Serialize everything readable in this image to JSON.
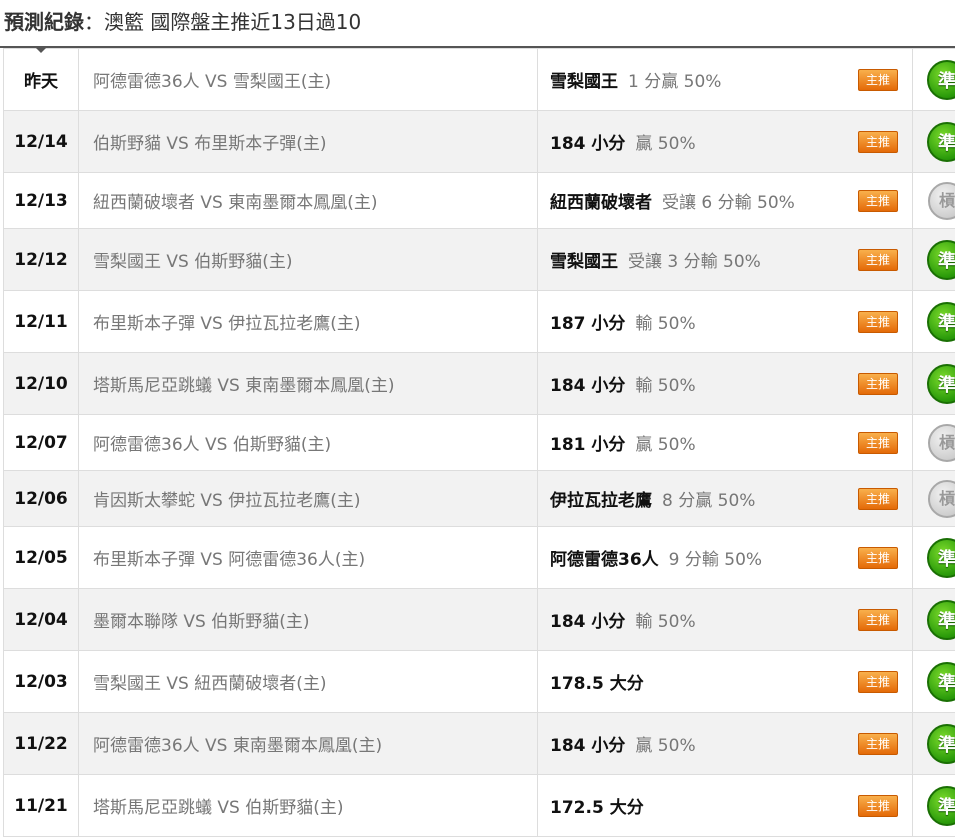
{
  "header": {
    "label": "預測紀錄",
    "sep": "：",
    "subtitle": "澳籃 國際盤主推近13日過10"
  },
  "rows": [
    {
      "date": "昨天",
      "match": "阿德雷德36人 VS 雪梨國王(主)",
      "pick_team": "雪梨國王",
      "pick_line": "1 分贏 50%",
      "badge": "主推",
      "result": "準",
      "result_type": "win"
    },
    {
      "date": "12/14",
      "match": "伯斯野貓 VS 布里斯本子彈(主)",
      "pick_team": "184 小分",
      "pick_line": "贏 50%",
      "badge": "主推",
      "result": "準",
      "result_type": "win"
    },
    {
      "date": "12/13",
      "match": "紐西蘭破壞者 VS 東南墨爾本鳳凰(主)",
      "pick_team": "紐西蘭破壞者",
      "pick_line": "受讓 6 分輸 50%",
      "badge": "主推",
      "result": "槓",
      "result_type": "lose"
    },
    {
      "date": "12/12",
      "match": "雪梨國王 VS 伯斯野貓(主)",
      "pick_team": "雪梨國王",
      "pick_line": "受讓 3 分輸 50%",
      "badge": "主推",
      "result": "準",
      "result_type": "win"
    },
    {
      "date": "12/11",
      "match": "布里斯本子彈 VS 伊拉瓦拉老鷹(主)",
      "pick_team": "187 小分",
      "pick_line": "輸 50%",
      "badge": "主推",
      "result": "準",
      "result_type": "win"
    },
    {
      "date": "12/10",
      "match": "塔斯馬尼亞跳蟻 VS 東南墨爾本鳳凰(主)",
      "pick_team": "184 小分",
      "pick_line": "輸 50%",
      "badge": "主推",
      "result": "準",
      "result_type": "win"
    },
    {
      "date": "12/07",
      "match": "阿德雷德36人 VS 伯斯野貓(主)",
      "pick_team": "181 小分",
      "pick_line": "贏 50%",
      "badge": "主推",
      "result": "槓",
      "result_type": "lose"
    },
    {
      "date": "12/06",
      "match": "肯因斯太攀蛇 VS 伊拉瓦拉老鷹(主)",
      "pick_team": "伊拉瓦拉老鷹",
      "pick_line": "8 分贏 50%",
      "badge": "主推",
      "result": "槓",
      "result_type": "lose"
    },
    {
      "date": "12/05",
      "match": "布里斯本子彈 VS 阿德雷德36人(主)",
      "pick_team": "阿德雷德36人",
      "pick_line": "9 分輸 50%",
      "badge": "主推",
      "result": "準",
      "result_type": "win"
    },
    {
      "date": "12/04",
      "match": "墨爾本聯隊 VS 伯斯野貓(主)",
      "pick_team": "184 小分",
      "pick_line": "輸 50%",
      "badge": "主推",
      "result": "準",
      "result_type": "win"
    },
    {
      "date": "12/03",
      "match": "雪梨國王 VS 紐西蘭破壞者(主)",
      "pick_team": "178.5 大分",
      "pick_line": "",
      "badge": "主推",
      "result": "準",
      "result_type": "win"
    },
    {
      "date": "11/22",
      "match": "阿德雷德36人 VS 東南墨爾本鳳凰(主)",
      "pick_team": "184 小分",
      "pick_line": "贏 50%",
      "badge": "主推",
      "result": "準",
      "result_type": "win"
    },
    {
      "date": "11/21",
      "match": "塔斯馬尼亞跳蟻 VS 伯斯野貓(主)",
      "pick_team": "172.5 大分",
      "pick_line": "",
      "badge": "主推",
      "result": "準",
      "result_type": "win"
    }
  ]
}
